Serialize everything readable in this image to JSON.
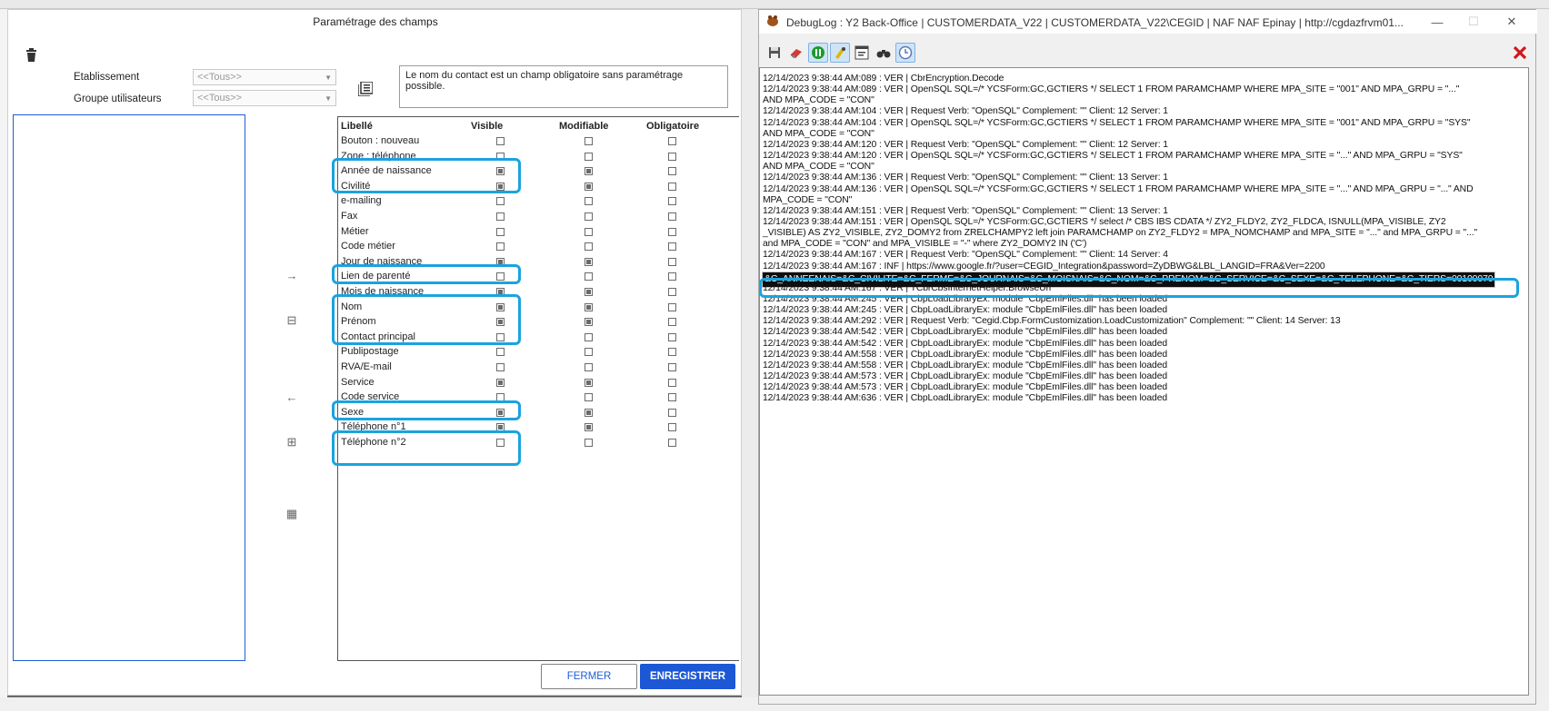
{
  "dialog": {
    "title": "Paramétrage des champs",
    "etablissement_label": "Etablissement",
    "etablissement_value": "<<Tous>>",
    "groupe_label": "Groupe utilisateurs",
    "groupe_value": "<<Tous>>",
    "info_text": "Le nom du contact est un champ obligatoire sans paramétrage possible.",
    "columns": [
      "Libellé",
      "Visible",
      "Modifiable",
      "Obligatoire"
    ],
    "rows": [
      {
        "label": "Bouton : nouveau",
        "visible": false,
        "modifiable": false,
        "obligatoire": false
      },
      {
        "label": "Zone : téléphone",
        "visible": false,
        "modifiable": false,
        "obligatoire": false
      },
      {
        "label": "Année de naissance",
        "visible": true,
        "modifiable": true,
        "obligatoire": false
      },
      {
        "label": "Civilité",
        "visible": true,
        "modifiable": true,
        "obligatoire": false
      },
      {
        "label": "e-mailing",
        "visible": false,
        "modifiable": false,
        "obligatoire": false
      },
      {
        "label": "Fax",
        "visible": false,
        "modifiable": false,
        "obligatoire": false
      },
      {
        "label": "Métier",
        "visible": false,
        "modifiable": false,
        "obligatoire": false
      },
      {
        "label": "Code métier",
        "visible": false,
        "modifiable": false,
        "obligatoire": false
      },
      {
        "label": "Jour de naissance",
        "visible": true,
        "modifiable": true,
        "obligatoire": false
      },
      {
        "label": "Lien de parenté",
        "visible": false,
        "modifiable": false,
        "obligatoire": false
      },
      {
        "label": "Mois de naissance",
        "visible": true,
        "modifiable": true,
        "obligatoire": false
      },
      {
        "label": "Nom",
        "visible": true,
        "modifiable": true,
        "obligatoire": false
      },
      {
        "label": "Prénom",
        "visible": true,
        "modifiable": true,
        "obligatoire": false
      },
      {
        "label": "Contact principal",
        "visible": false,
        "modifiable": false,
        "obligatoire": false
      },
      {
        "label": "Publipostage",
        "visible": false,
        "modifiable": false,
        "obligatoire": false
      },
      {
        "label": "RVA/E-mail",
        "visible": false,
        "modifiable": false,
        "obligatoire": false
      },
      {
        "label": "Service",
        "visible": true,
        "modifiable": true,
        "obligatoire": false
      },
      {
        "label": "Code service",
        "visible": false,
        "modifiable": false,
        "obligatoire": false
      },
      {
        "label": "Sexe",
        "visible": true,
        "modifiable": true,
        "obligatoire": false
      },
      {
        "label": "Téléphone n°1",
        "visible": true,
        "modifiable": true,
        "obligatoire": false
      },
      {
        "label": "Téléphone n°2",
        "visible": false,
        "modifiable": false,
        "obligatoire": false
      }
    ],
    "close_label": "FERMER",
    "save_label": "ENREGISTRER"
  },
  "debug": {
    "title": "DebugLog : Y2 Back-Office   |   CUSTOMERDATA_V22   |   CUSTOMERDATA_V22\\CEGID   |   NAF NAF Epinay   |   http://cgdazfrvm01...",
    "log_lines": [
      "12/14/2023 9:38:44 AM:089 : VER | CbrEncryption.Decode",
      "12/14/2023 9:38:44 AM:089 : VER | OpenSQL SQL=/* YCSForm:GC,GCTIERS */  SELECT 1 FROM PARAMCHAMP WHERE MPA_SITE = \"001\" AND MPA_GRPU = \"...\"",
      "AND MPA_CODE = \"CON\"",
      "12/14/2023 9:38:44 AM:104 : VER | Request Verb: \"OpenSQL\" Complement: \"\" Client: 12 Server: 1",
      "12/14/2023 9:38:44 AM:104 : VER | OpenSQL SQL=/* YCSForm:GC,GCTIERS */  SELECT 1 FROM PARAMCHAMP WHERE MPA_SITE = \"001\" AND MPA_GRPU = \"SYS\"",
      "AND MPA_CODE = \"CON\"",
      "12/14/2023 9:38:44 AM:120 : VER | Request Verb: \"OpenSQL\" Complement: \"\" Client: 12 Server: 1",
      "12/14/2023 9:38:44 AM:120 : VER | OpenSQL SQL=/* YCSForm:GC,GCTIERS */  SELECT 1 FROM PARAMCHAMP WHERE MPA_SITE = \"...\" AND MPA_GRPU = \"SYS\"",
      "AND MPA_CODE = \"CON\"",
      "12/14/2023 9:38:44 AM:136 : VER | Request Verb: \"OpenSQL\" Complement: \"\" Client: 13 Server: 1",
      "12/14/2023 9:38:44 AM:136 : VER | OpenSQL SQL=/* YCSForm:GC,GCTIERS */  SELECT 1 FROM PARAMCHAMP WHERE MPA_SITE = \"...\" AND MPA_GRPU = \"...\" AND",
      "MPA_CODE = \"CON\"",
      "12/14/2023 9:38:44 AM:151 : VER | Request Verb: \"OpenSQL\" Complement: \"\" Client: 13 Server: 1",
      "12/14/2023 9:38:44 AM:151 : VER | OpenSQL SQL=/* YCSForm:GC,GCTIERS */  select /* CBS IBS CDATA */ ZY2_FLDY2, ZY2_FLDCA, ISNULL(MPA_VISIBLE, ZY2",
      "_VISIBLE) AS ZY2_VISIBLE, ZY2_DOMY2 from ZRELCHAMPY2 left join PARAMCHAMP on ZY2_FLDY2 = MPA_NOMCHAMP and MPA_SITE = \"...\" and MPA_GRPU = \"...\"",
      "and MPA_CODE = \"CON\" and MPA_VISIBLE = \"-\" where ZY2_DOMY2 IN ('C')",
      "12/14/2023 9:38:44 AM:167 : VER | Request Verb: \"OpenSQL\" Complement: \"\" Client: 14 Server: 4",
      "12/14/2023 9:38:44 AM:167 : INF | https://www.google.fr/?user=CEGID_Integration&password=ZyDBWG&LBL_LANGID=FRA&Ver=2200",
      "&C_ANNEENAIS=&C_CIVILITE=&C_FERME=&C_JOURNAIS=&C_MOISNAIS=&C_NOM=&C_PRENOM=&C_SERVICE=&C_SEXE=&C_TELEPHONE=&C_TIERS=00100070",
      "12/14/2023 9:38:44 AM:167 : VER | TCbrCbsInternetHelper.BrowseUrl",
      "12/14/2023 9:38:44 AM:245 : VER | CbpLoadLibraryEx: module \"CbpEmlFiles.dll\" has been loaded",
      "12/14/2023 9:38:44 AM:245 : VER | CbpLoadLibraryEx: module \"CbpEmlFiles.dll\" has been loaded",
      "12/14/2023 9:38:44 AM:292 : VER | Request Verb: \"Cegid.Cbp.FormCustomization.LoadCustomization\" Complement: \"\" Client: 14 Server: 13",
      "12/14/2023 9:38:44 AM:542 : VER | CbpLoadLibraryEx: module \"CbpEmlFiles.dll\" has been loaded",
      "12/14/2023 9:38:44 AM:542 : VER | CbpLoadLibraryEx: module \"CbpEmlFiles.dll\" has been loaded",
      "12/14/2023 9:38:44 AM:558 : VER | CbpLoadLibraryEx: module \"CbpEmlFiles.dll\" has been loaded",
      "12/14/2023 9:38:44 AM:558 : VER | CbpLoadLibraryEx: module \"CbpEmlFiles.dll\" has been loaded",
      "12/14/2023 9:38:44 AM:573 : VER | CbpLoadLibraryEx: module \"CbpEmlFiles.dll\" has been loaded",
      "12/14/2023 9:38:44 AM:573 : VER | CbpLoadLibraryEx: module \"CbpEmlFiles.dll\" has been loaded",
      "12/14/2023 9:38:44 AM:636 : VER | CbpLoadLibraryEx: module \"CbpEmlFiles.dll\" has been loaded"
    ],
    "selected_line_index": 18
  },
  "colors": {
    "accent": "#1c57d6",
    "highlight": "#1aa3e0"
  }
}
